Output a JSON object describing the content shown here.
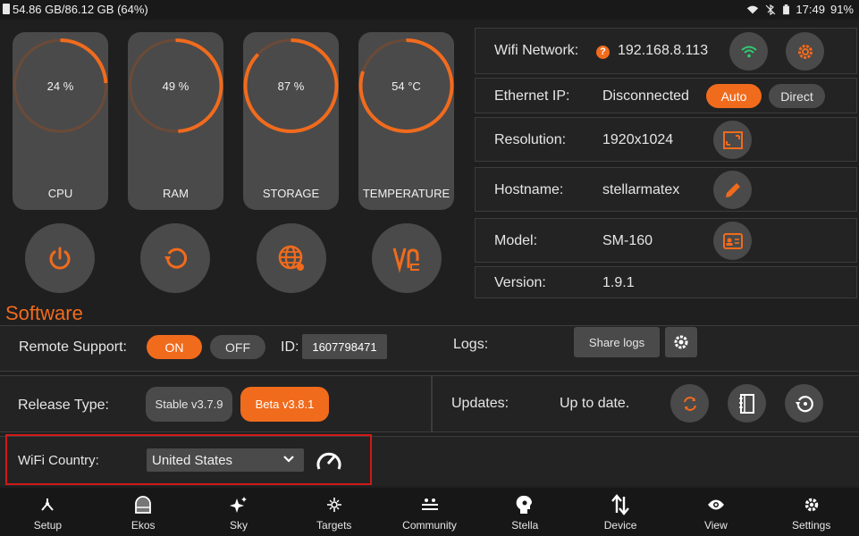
{
  "status_bar": {
    "storage_text": "54.86 GB/86.12 GB (64%)",
    "time": "17:49",
    "battery": "91%"
  },
  "gauges": [
    {
      "label": "CPU",
      "value_text": "24 %",
      "fraction": 0.24
    },
    {
      "label": "RAM",
      "value_text": "49 %",
      "fraction": 0.49
    },
    {
      "label": "STORAGE",
      "value_text": "87 %",
      "fraction": 0.87
    },
    {
      "label": "TEMPERATURE",
      "value_text": "54 °C",
      "fraction": 0.8
    }
  ],
  "action_buttons": [
    {
      "icon": "power-icon"
    },
    {
      "icon": "restart-icon"
    },
    {
      "icon": "web-manager-icon"
    },
    {
      "icon": "vnc-icon"
    }
  ],
  "network": {
    "wifi_label": "Wifi Network:",
    "wifi_ip": "192.168.8.113",
    "wifi_status_icon": "question-icon",
    "ethernet_label": "Ethernet IP:",
    "ethernet_value": "Disconnected",
    "auto_label": "Auto",
    "direct_label": "Direct",
    "resolution_label": "Resolution:",
    "resolution_value": "1920x1024",
    "hostname_label": "Hostname:",
    "hostname_value": "stellarmatex",
    "model_label": "Model:",
    "model_value": "SM-160",
    "version_label": "Version:",
    "version_value": "1.9.1"
  },
  "software": {
    "title": "Software",
    "remote_support_label": "Remote Support:",
    "on_label": "ON",
    "off_label": "OFF",
    "id_label": "ID:",
    "id_value": "1607798471",
    "logs_label": "Logs:",
    "share_logs_label": "Share logs",
    "release_type_label": "Release Type:",
    "stable_label": "Stable v3.7.9",
    "beta_label": "Beta v3.8.1",
    "updates_label": "Updates:",
    "updates_status": "Up to date.",
    "wifi_country_label": "WiFi Country:",
    "wifi_country_value": "United States"
  },
  "bottom_nav": [
    {
      "label": "Setup",
      "icon": "setup-icon"
    },
    {
      "label": "Ekos",
      "icon": "ekos-icon"
    },
    {
      "label": "Sky",
      "icon": "sky-icon"
    },
    {
      "label": "Targets",
      "icon": "targets-icon"
    },
    {
      "label": "Community",
      "icon": "community-icon"
    },
    {
      "label": "Stella",
      "icon": "stella-icon"
    },
    {
      "label": "Device",
      "icon": "device-icon"
    },
    {
      "label": "View",
      "icon": "view-icon"
    },
    {
      "label": "Settings",
      "icon": "settings-icon"
    }
  ],
  "colors": {
    "accent": "#f16b1d",
    "card": "#4a4a4a",
    "background": "#1f1f1f",
    "wifi_green": "#2ecc71",
    "highlight_red": "#d01a1a"
  }
}
